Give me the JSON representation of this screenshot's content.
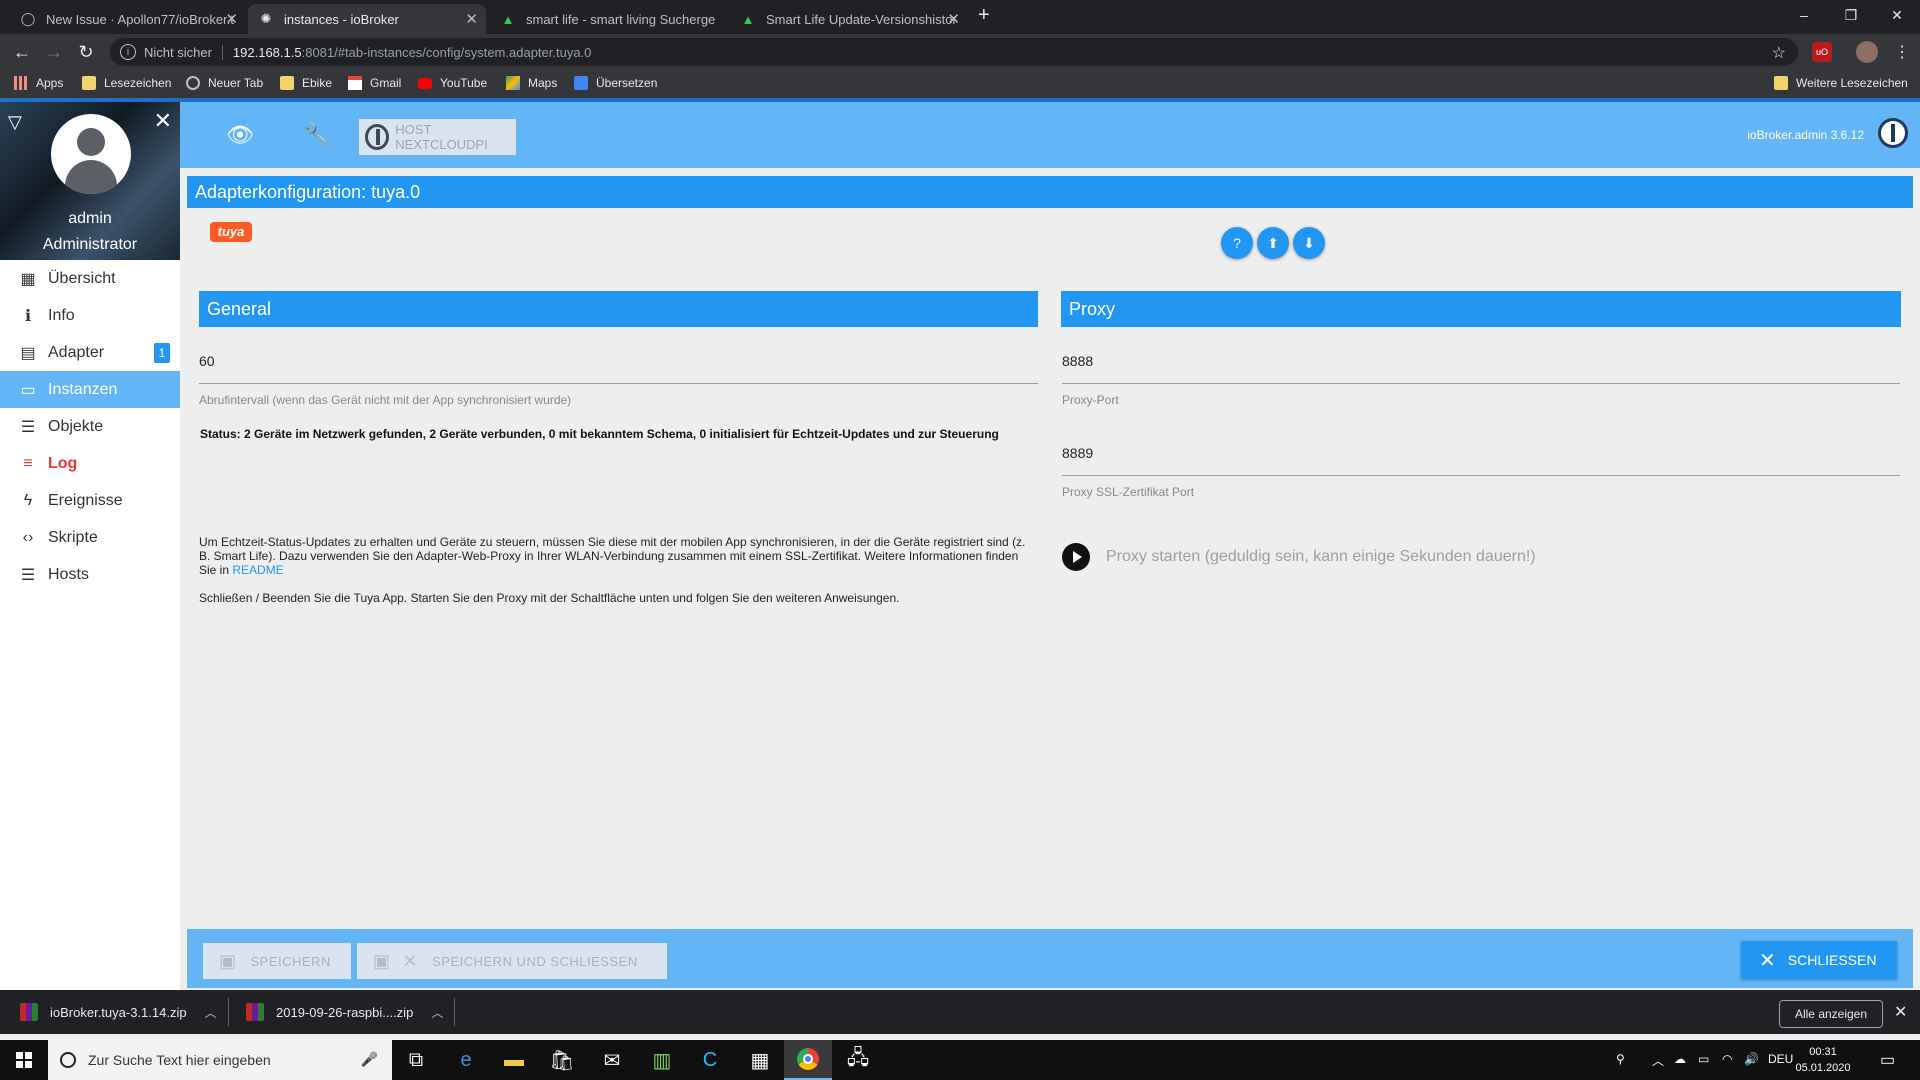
{
  "browser": {
    "tabs": [
      {
        "title": "New Issue · Apollon77/ioBroker.t",
        "icon": "github-icon",
        "active": false
      },
      {
        "title": "instances - ioBroker",
        "icon": "iobroker-icon",
        "active": true
      },
      {
        "title": "smart life - smart living Sucherge",
        "icon": "apkpure-icon",
        "active": false
      },
      {
        "title": "Smart Life Update-Versionshistor",
        "icon": "apkpure-icon",
        "active": false
      }
    ],
    "new_tab": "+",
    "window_controls": {
      "minimize": "–",
      "maximize": "❐",
      "close": "✕"
    },
    "address": {
      "security_label": "Nicht sicher",
      "url_host": "192.168.1.5",
      "url_path": ":8081/#tab-instances/config/system.adapter.tuya.0"
    },
    "bookmarks": [
      {
        "label": "Apps",
        "icon": "apps-grid-icon"
      },
      {
        "label": "Lesezeichen",
        "icon": "folder-icon"
      },
      {
        "label": "Neuer Tab",
        "icon": "globe-icon"
      },
      {
        "label": "Ebike",
        "icon": "folder-icon"
      },
      {
        "label": "Gmail",
        "icon": "gmail-icon"
      },
      {
        "label": "YouTube",
        "icon": "youtube-icon"
      },
      {
        "label": "Maps",
        "icon": "maps-icon"
      },
      {
        "label": "Übersetzen",
        "icon": "translate-icon"
      }
    ],
    "other_bookmarks": "Weitere Lesezeichen"
  },
  "sidebar": {
    "user_name": "admin",
    "user_role": "Administrator",
    "items": [
      {
        "label": "Übersicht",
        "icon": "grid-icon",
        "glyph": "▦"
      },
      {
        "label": "Info",
        "icon": "info-icon",
        "glyph": "ℹ"
      },
      {
        "label": "Adapter",
        "icon": "store-icon",
        "glyph": "▤",
        "badge": "1"
      },
      {
        "label": "Instanzen",
        "icon": "instances-icon",
        "glyph": "▭"
      },
      {
        "label": "Objekte",
        "icon": "list-icon",
        "glyph": "☰"
      },
      {
        "label": "Log",
        "icon": "log-icon",
        "glyph": "≡"
      },
      {
        "label": "Ereignisse",
        "icon": "flash-icon",
        "glyph": "ϟ"
      },
      {
        "label": "Skripte",
        "icon": "code-icon",
        "glyph": "‹›"
      },
      {
        "label": "Hosts",
        "icon": "hosts-icon",
        "glyph": "☰"
      }
    ]
  },
  "topbar": {
    "host_button": "HOST NEXTCLOUDPI",
    "version": "ioBroker.admin 3.6.12"
  },
  "config": {
    "title": "Adapterkonfiguration: tuya.0",
    "logo_text": "tuya",
    "general": {
      "heading": "General",
      "interval_value": "60",
      "interval_label": "Abrufintervall (wenn das Gerät nicht mit der App synchronisiert wurde)",
      "status": "Status: 2 Geräte im Netzwerk gefunden, 2 Geräte verbunden, 0 mit bekanntem Schema, 0 initialisiert für Echtzeit-Updates und zur Steuerung",
      "info_text": "Um Echtzeit-Status-Updates zu erhalten und Geräte zu steuern, müssen Sie diese mit der mobilen App synchronisieren, in der die Geräte registriert sind (z. B. Smart Life). Dazu verwenden Sie den Adapter-Web-Proxy in Ihrer WLAN-Verbindung zusammen mit einem SSL-Zertifikat. Weitere Informationen finden Sie in",
      "readme_link": "README",
      "close_app_text": "Schließen / Beenden Sie die Tuya App. Starten Sie den Proxy mit der Schaltfläche unten und folgen Sie den weiteren Anweisungen."
    },
    "proxy": {
      "heading": "Proxy",
      "port_value": "8888",
      "port_label": "Proxy-Port",
      "ssl_port_value": "8889",
      "ssl_port_label": "Proxy SSL-Zertifikat Port",
      "start_label": "Proxy starten (geduldig sein, kann einige Sekunden dauern!)"
    }
  },
  "footer": {
    "save": "SPEICHERN",
    "save_close": "SPEICHERN UND SCHLIESSEN",
    "close": "SCHLIESSEN"
  },
  "downloads": {
    "items": [
      "ioBroker.tuya-3.1.14.zip",
      "2019-09-26-raspbi....zip"
    ],
    "show_all": "Alle anzeigen"
  },
  "taskbar": {
    "search_placeholder": "Zur Suche Text hier eingeben",
    "language": "DEU",
    "time": "00:31",
    "date": "05.01.2020"
  }
}
